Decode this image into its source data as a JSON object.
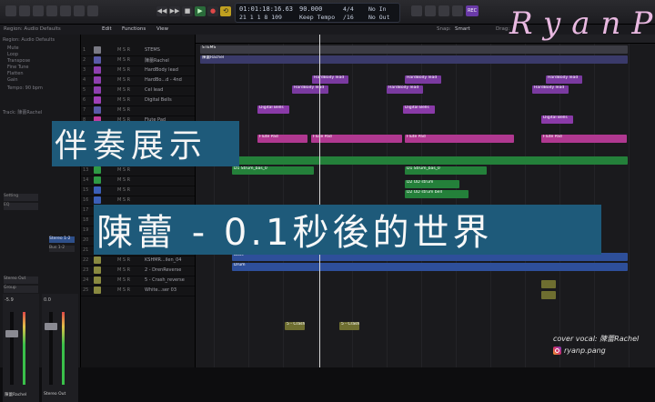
{
  "transport": {
    "time": "01:01:18:16.63",
    "bars": "21  1  1    8    109",
    "bpm": "90.000",
    "bpm_mode": "Keep Tempo",
    "signature": "4/4",
    "division": "/16",
    "in_label": "No In",
    "out_label": "No Out",
    "rec_badge": "REC"
  },
  "controlbar": {
    "region": "Region: Audio Defaults",
    "edit": "Edit",
    "functions": "Functions",
    "view": "View",
    "snap_label": "Snap:",
    "snap_value": "Smart",
    "drag_label": "Drag:"
  },
  "inspector": {
    "region_label": "Region: Audio Defaults",
    "track_label": "Track: 陳蕾Rachel",
    "mute": "Mute",
    "loop": "Loop",
    "transpose": "Transpose",
    "fine_tune": "Fine Tune",
    "flatten": "Flatten",
    "gain": "Gain",
    "tempo_label": "Tempo: 90 bpm",
    "setting": "Setting",
    "eq": "EQ",
    "inserts": "Stereo 1-2",
    "bus": "Bus 1-2",
    "stereo_out": "Stereo Out",
    "group": "Group",
    "read": "Read",
    "strip1_name": "陳蕾Rachel",
    "strip2_name": "Stereo Out",
    "volume1": "-5.9",
    "volume2": "0.0"
  },
  "tracks": [
    {
      "num": "1",
      "name": "STEMS",
      "color": "#7a7a84"
    },
    {
      "num": "2",
      "name": "陳蕾Rachel",
      "color": "#5a5aa8"
    },
    {
      "num": "3",
      "name": "HardBody lead",
      "color": "#8e3fb0"
    },
    {
      "num": "4",
      "name": "HardBo...d - 4nd",
      "color": "#8e3fb0"
    },
    {
      "num": "5",
      "name": "Cel lead",
      "color": "#8e3fb0"
    },
    {
      "num": "6",
      "name": "Digital Bells",
      "color": "#a040b8"
    },
    {
      "num": "7",
      "name": "",
      "color": "#5a5aa8"
    },
    {
      "num": "8",
      "name": "Flute Pad",
      "color": "#c03ca0"
    },
    {
      "num": "9",
      "name": "",
      "color": "#2e9a44"
    },
    {
      "num": "10",
      "name": "D1 Strum_bas",
      "color": "#2e9a44"
    },
    {
      "num": "11",
      "name": "D2 OD strum",
      "color": "#2e9a44"
    },
    {
      "num": "12",
      "name": "D2 OD...sts bell",
      "color": "#2e9a44"
    },
    {
      "num": "13",
      "name": "",
      "color": "#2e9a44"
    },
    {
      "num": "14",
      "name": "",
      "color": "#2e9a44"
    },
    {
      "num": "15",
      "name": "",
      "color": "#3b5fb8"
    },
    {
      "num": "16",
      "name": "",
      "color": "#3b5fb8"
    },
    {
      "num": "17",
      "name": "",
      "color": "#3b5fb8"
    },
    {
      "num": "18",
      "name": "Bass",
      "color": "#3b5fb8"
    },
    {
      "num": "19",
      "name": "Drum",
      "color": "#3b5fb8"
    },
    {
      "num": "20",
      "name": "UNsam..._DS_90",
      "color": "#8a8a40"
    },
    {
      "num": "21",
      "name": "lite_fun...ass_95",
      "color": "#8a8a40"
    },
    {
      "num": "22",
      "name": "KSHMR...ilen_04",
      "color": "#8a8a40"
    },
    {
      "num": "23",
      "name": "2 - DrenReverse",
      "color": "#8a8a40"
    },
    {
      "num": "24",
      "name": "5 - Crash_reverse",
      "color": "#8a8a40"
    },
    {
      "num": "25",
      "name": "White...ser 03",
      "color": "#8a8a40"
    }
  ],
  "regions": {
    "stems": "STEMS",
    "rachel": "陳蕾Rachel",
    "hardbody": "HardBody lead",
    "hardbody4": "HardBody lead",
    "digital": "Digital Bells",
    "flute": "Flute Pad",
    "strum": "D1 Strum_bas_0",
    "odstrum": "D2 OD strum",
    "odbell": "D2 OD strum bell",
    "bass": "Bass",
    "drum": "Drum",
    "crash": "5 - Crash"
  },
  "overlay": {
    "title": "伴奏展示",
    "song": "陳蕾 - 0.1秒後的世界",
    "logo": "RyanP",
    "credit_vocal": "cover vocal: 陳蕾Rachel",
    "credit_ig": "ryanp.pang"
  },
  "colors": {
    "overlay_box": "#1e5a7a",
    "logo": "#e8b8e0"
  }
}
